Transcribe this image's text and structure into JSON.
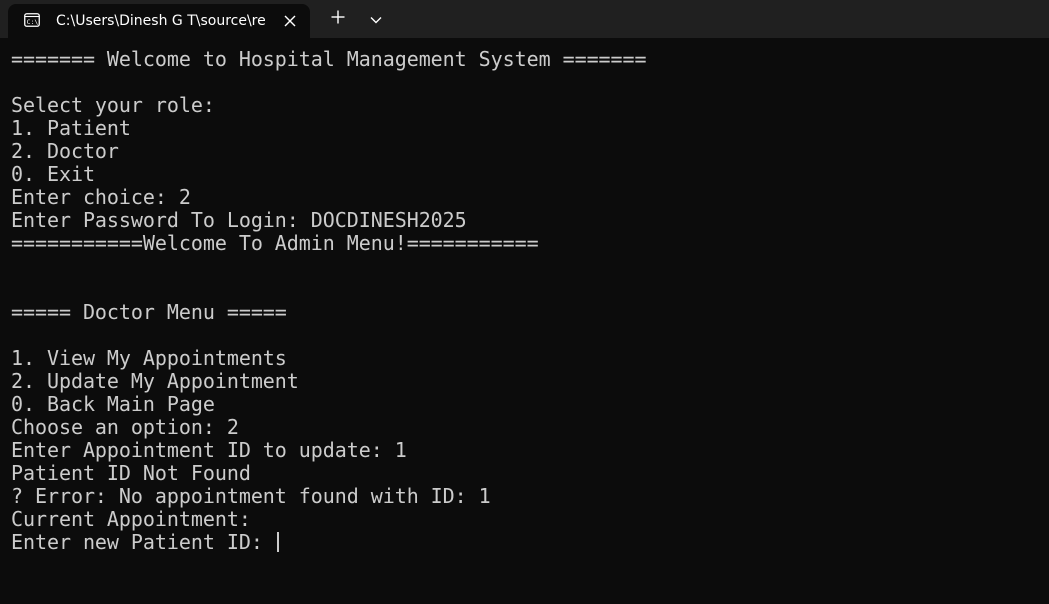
{
  "window": {
    "tab_title": "C:\\Users\\Dinesh G T\\source\\re",
    "icons": {
      "tab": "terminal-icon",
      "close": "close-icon",
      "new_tab": "plus-icon",
      "dropdown": "chevron-down-icon"
    }
  },
  "console": {
    "lines": [
      "======= Welcome to Hospital Management System =======",
      "",
      "Select your role:",
      "1. Patient",
      "2. Doctor",
      "0. Exit",
      "Enter choice: 2",
      "Enter Password To Login: DOCDINESH2025",
      "===========Welcome To Admin Menu!===========",
      "",
      "",
      "===== Doctor Menu =====",
      "",
      "1. View My Appointments",
      "2. Update My Appointment",
      "0. Back Main Page",
      "Choose an option: 2",
      "Enter Appointment ID to update: 1",
      "Patient ID Not Found",
      "? Error: No appointment found with ID: 1",
      "Current Appointment:",
      "Enter new Patient ID: "
    ]
  },
  "colors": {
    "background": "#0c0c0c",
    "titlebar": "#202020",
    "text": "#cccccc"
  }
}
